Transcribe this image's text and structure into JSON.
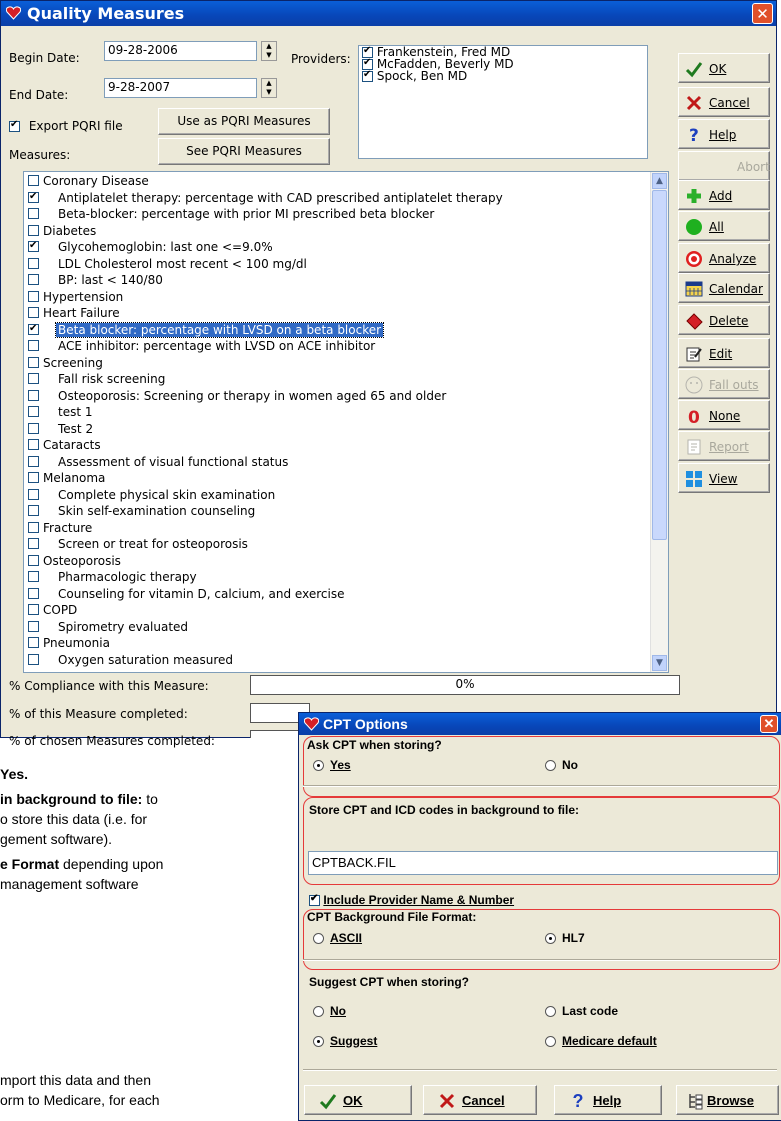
{
  "quality_measures": {
    "title": "Quality Measures",
    "begin_date_label": "Begin Date:",
    "begin_date_value": "09-28-2006",
    "end_date_label": "End Date:",
    "end_date_value": "9-28-2007",
    "providers_label": "Providers:",
    "providers": [
      {
        "name": "Frankenstein, Fred MD",
        "checked": true
      },
      {
        "name": "McFadden, Beverly MD",
        "checked": true
      },
      {
        "name": "Spock, Ben MD",
        "checked": true
      }
    ],
    "export_pqri_label": "Export PQRI file",
    "export_pqri_checked": true,
    "use_as_pqri_label": "Use as PQRI  Measures",
    "see_pqri_label": "See PQRI Measures",
    "measures_label": "Measures:",
    "measures": [
      {
        "text": "Coronary Disease",
        "level": 0,
        "checked": false
      },
      {
        "text": "Antiplatelet therapy: percentage with CAD prescribed antiplatelet therapy",
        "level": 1,
        "checked": true
      },
      {
        "text": "Beta-blocker: percentage with prior MI prescribed beta blocker",
        "level": 1,
        "checked": false
      },
      {
        "text": "Diabetes",
        "level": 0,
        "checked": false
      },
      {
        "text": "Glycohemoglobin: last one <=9.0%",
        "level": 1,
        "checked": true
      },
      {
        "text": "LDL Cholesterol most recent < 100 mg/dl",
        "level": 1,
        "checked": false
      },
      {
        "text": "BP: last < 140/80",
        "level": 1,
        "checked": false
      },
      {
        "text": "Hypertension",
        "level": 0,
        "checked": false
      },
      {
        "text": "Heart Failure",
        "level": 0,
        "checked": false
      },
      {
        "text": "Beta blocker: percentage with LVSD on a beta blocker",
        "level": 1,
        "checked": true,
        "selected": true
      },
      {
        "text": "ACE inhibitor: percentage with LVSD on ACE inhibitor",
        "level": 1,
        "checked": false
      },
      {
        "text": "Screening",
        "level": 0,
        "checked": false
      },
      {
        "text": "Fall risk screening",
        "level": 1,
        "checked": false
      },
      {
        "text": "Osteoporosis: Screening or therapy in women aged 65 and older",
        "level": 1,
        "checked": false
      },
      {
        "text": "test 1",
        "level": 1,
        "checked": false
      },
      {
        "text": "Test 2",
        "level": 1,
        "checked": false
      },
      {
        "text": "Cataracts",
        "level": 0,
        "checked": false
      },
      {
        "text": "Assessment of visual functional status",
        "level": 1,
        "checked": false
      },
      {
        "text": "Melanoma",
        "level": 0,
        "checked": false
      },
      {
        "text": "Complete physical skin examination",
        "level": 1,
        "checked": false
      },
      {
        "text": "Skin self-examination counseling",
        "level": 1,
        "checked": false
      },
      {
        "text": "Fracture",
        "level": 0,
        "checked": false
      },
      {
        "text": "Screen or treat for osteoporosis",
        "level": 1,
        "checked": false
      },
      {
        "text": "Osteoporosis",
        "level": 0,
        "checked": false
      },
      {
        "text": "Pharmacologic therapy",
        "level": 1,
        "checked": false
      },
      {
        "text": "Counseling for vitamin D, calcium, and exercise",
        "level": 1,
        "checked": false
      },
      {
        "text": "COPD",
        "level": 0,
        "checked": false
      },
      {
        "text": "Spirometry evaluated",
        "level": 1,
        "checked": false
      },
      {
        "text": "Pneumonia",
        "level": 0,
        "checked": false
      },
      {
        "text": "Oxygen saturation measured",
        "level": 1,
        "checked": false
      }
    ],
    "side_buttons": [
      {
        "label": "OK",
        "icon": "checkmark-icon",
        "enabled": true
      },
      {
        "label": "Cancel",
        "icon": "x-icon",
        "enabled": true
      },
      {
        "label": "Help",
        "icon": "question-icon",
        "enabled": true
      },
      {
        "label": "Abort",
        "icon": "",
        "enabled": false
      },
      {
        "label": "Add",
        "icon": "plus-icon",
        "enabled": true
      },
      {
        "label": "All",
        "icon": "green-circle-icon",
        "enabled": true
      },
      {
        "label": "Analyze",
        "icon": "target-icon",
        "enabled": true
      },
      {
        "label": "Calendar",
        "icon": "calendar-icon",
        "enabled": true
      },
      {
        "label": "Delete",
        "icon": "eraser-icon",
        "enabled": true
      },
      {
        "label": "Edit",
        "icon": "edit-icon",
        "enabled": true
      },
      {
        "label": "Fall outs",
        "icon": "faces-icon",
        "enabled": false
      },
      {
        "label": "None",
        "icon": "zero-icon",
        "enabled": true
      },
      {
        "label": "Report",
        "icon": "report-icon",
        "enabled": false
      },
      {
        "label": "View",
        "icon": "windows-grid-icon",
        "enabled": true
      }
    ],
    "compliance_label": "% Compliance with this Measure:",
    "compliance_value": "0%",
    "measure_completed_label": "% of this Measure completed:",
    "chosen_completed_label": "% of chosen Measures completed:"
  },
  "document_text": {
    "line1": "Yes.",
    "line2_bold": "in background to file:",
    "line2_rest": " to",
    "line3": "o store this data (i.e. for",
    "line4": "gement software).",
    "line5_bold": "e Format",
    "line5_rest": " depending upon",
    "line6": "management  software",
    "line7": "mport this data and then",
    "line8": "orm to Medicare, for each"
  },
  "cpt_options": {
    "title": "CPT Options",
    "ask_cpt_label": "Ask CPT when storing?",
    "ask_yes": "Yes",
    "ask_no": "No",
    "ask_selected": "yes",
    "store_label": "Store CPT and ICD codes in background to file:",
    "store_value": "CPTBACK.FIL",
    "include_provider_label": "Include Provider Name & Number",
    "include_provider_checked": true,
    "format_label": "CPT Background File Format:",
    "format_ascii": "ASCII",
    "format_hl7": "HL7",
    "format_selected": "hl7",
    "suggest_label": "Suggest CPT when storing?",
    "suggest_no": "No",
    "suggest_last": "Last code",
    "suggest_suggest": "Suggest",
    "suggest_medicare": "Medicare default",
    "suggest_selected": "suggest",
    "ok_label": "OK",
    "cancel_label": "Cancel",
    "help_label": "Help",
    "browse_label": "Browse"
  },
  "colors": {
    "titlebar": "#0a53c8",
    "selection": "#316ac5",
    "window_bg": "#ece9d8",
    "highlight_box": "#e53a3a"
  }
}
